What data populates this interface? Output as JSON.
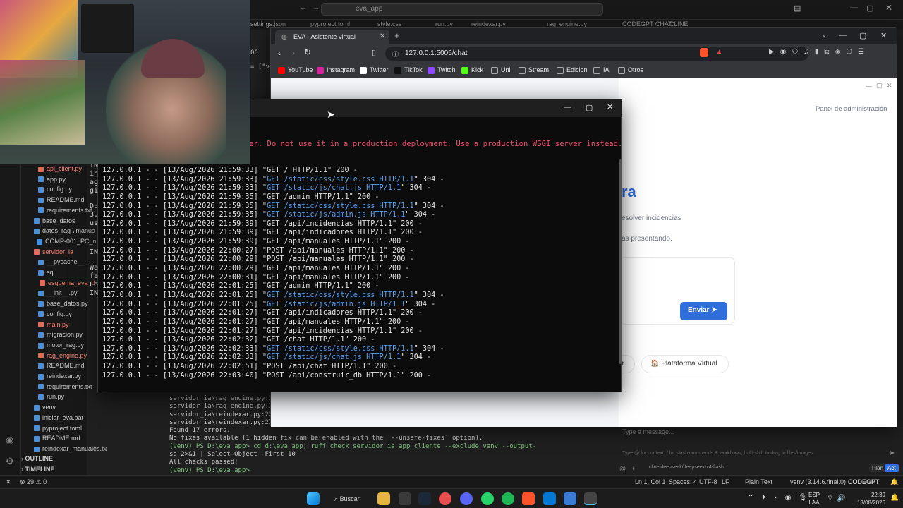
{
  "vscode": {
    "search_text": "eva_app",
    "tabs": [
      "settings.json",
      "pyproject.toml",
      "style.css",
      "run.py",
      "reindexar.py",
      "rag_engine.py",
      "CODEGPT CHAT",
      "CLINE"
    ],
    "tree": [
      {
        "label": "api_client.py",
        "color": "#f48771"
      },
      {
        "label": "app.py",
        "color": "#cccccc"
      },
      {
        "label": "config.py",
        "color": "#cccccc"
      },
      {
        "label": "README.md",
        "color": "#cccccc"
      },
      {
        "label": "requirements.txt",
        "color": "#cccccc"
      },
      {
        "label": "base_datos",
        "color": "#cccccc"
      },
      {
        "label": "datos_rag \\ manua",
        "color": "#cccccc"
      },
      {
        "label": "COMP-001_PC_n",
        "color": "#cccccc"
      },
      {
        "label": "servidor_ia",
        "color": "#f48771"
      },
      {
        "label": "__pycache__",
        "color": "#cccccc"
      },
      {
        "label": "sql",
        "color": "#cccccc"
      },
      {
        "label": "esquema_eva_d",
        "color": "#f48771"
      },
      {
        "label": "__init__.py",
        "color": "#cccccc"
      },
      {
        "label": "base_datos.py",
        "color": "#cccccc"
      },
      {
        "label": "config.py",
        "color": "#cccccc"
      },
      {
        "label": "main.py",
        "color": "#f48771"
      },
      {
        "label": "migracion.py",
        "color": "#cccccc"
      },
      {
        "label": "motor_rag.py",
        "color": "#cccccc"
      },
      {
        "label": "rag_engine.py",
        "color": "#f48771"
      },
      {
        "label": "README.md",
        "color": "#cccccc"
      },
      {
        "label": "reindexar.py",
        "color": "#cccccc"
      },
      {
        "label": "requirements.txt",
        "color": "#cccccc"
      },
      {
        "label": "run.py",
        "color": "#cccccc"
      },
      {
        "label": "venv",
        "color": "#cccccc"
      },
      {
        "label": "iniciar_eva.bat",
        "color": "#cccccc"
      },
      {
        "label": "pyproject.toml",
        "color": "#cccccc"
      },
      {
        "label": "README.md",
        "color": "#cccccc"
      },
      {
        "label": "reindexar_manuales.bat",
        "color": "#cccccc"
      }
    ],
    "outline_label": "OUTLINE",
    "timeline_label": "TIMELINE",
    "terminal_lines": [
      "servidor_ia\\rag_engine.py:159",
      "servidor_ia\\rag_engine.py:173",
      "servidor_ia\\reindexar.py:22:12",
      "servidor_ia\\reindexar.py:27:13",
      "Found 17 errors.",
      "No fixes available (1 hidden fix can be enabled with the `--unsafe-fixes` option).",
      "(venv) PS D:\\eva_app> cd d:\\eva_app; ruff check servidor_ia app_cliente --exclude venv --output-format conci",
      "se 2>&1 | Select-Object -First 10",
      "All checks passed!",
      "(venv) PS D:\\eva_app> "
    ],
    "chat_placeholder": "Type a message...",
    "chat_hint": "Type @ for context, / for slash commands & workflows, hold shift to drag in files/images",
    "chat_model": "cline:deepseek/deepseek-v4-flash",
    "plan_label": "Plan",
    "act_label": "Act",
    "status": {
      "errors": "29",
      "warnings": "0",
      "position": "Ln 1, Col 1",
      "spaces": "Spaces: 4",
      "encoding": "UTF-8",
      "eol": "LF",
      "language": "Plain Text",
      "python": "venv (3.14.6.final.0)",
      "codegpt": "CODEGPT"
    }
  },
  "browser": {
    "tab_title": "EVA - Asistente virtual",
    "url": "127.0.0.1:5005/chat",
    "bookmarks": [
      "YouTube",
      "Instagram",
      "Twitter",
      "TikTok",
      "Twitch",
      "Kick",
      "Uni",
      "Stream",
      "Edicion",
      "IA",
      "Otros"
    ],
    "admin_link": "Panel de administración",
    "heading_fragment": "ra",
    "line1": "esolver incidencias",
    "line2": "ás presentando.",
    "send_button": "Enviar",
    "chip1": "or",
    "chip2": "Plataforma Virtual"
  },
  "console": {
    "warning": "er. Do not use it in a production deployment. Use a production WSGI server instead.",
    "left_fragments": [
      "IN",
      "in",
      "ag",
      "gi",
      "D:",
      "3.",
      "us",
      "IN",
      "Wa",
      "fa",
      "Lo",
      "IN"
    ],
    "log": [
      {
        "pre": "127.0.0.1 - - [13/Aug/2026 21:59:33] \"",
        "req": "GET / HTTP/1.1",
        "post": "\" 200 -",
        "hl": false
      },
      {
        "pre": "127.0.0.1 - - [13/Aug/2026 21:59:33] \"",
        "req": "GET /static/css/style.css HTTP/1.1",
        "post": "\" 304 -",
        "hl": true
      },
      {
        "pre": "127.0.0.1 - - [13/Aug/2026 21:59:33] \"",
        "req": "GET /static/js/chat.js HTTP/1.1",
        "post": "\" 304 -",
        "hl": true
      },
      {
        "pre": "127.0.0.1 - - [13/Aug/2026 21:59:35] \"",
        "req": "GET /admin HTTP/1.1",
        "post": "\" 200 -",
        "hl": false
      },
      {
        "pre": "127.0.0.1 - - [13/Aug/2026 21:59:35] \"",
        "req": "GET /static/css/style.css HTTP/1.1",
        "post": "\" 304 -",
        "hl": true
      },
      {
        "pre": "127.0.0.1 - - [13/Aug/2026 21:59:35] \"",
        "req": "GET /static/js/admin.js HTTP/1.1",
        "post": "\" 304 -",
        "hl": true
      },
      {
        "pre": "127.0.0.1 - - [13/Aug/2026 21:59:39] \"",
        "req": "GET /api/incidencias HTTP/1.1",
        "post": "\" 200 -",
        "hl": false
      },
      {
        "pre": "127.0.0.1 - - [13/Aug/2026 21:59:39] \"",
        "req": "GET /api/indicadores HTTP/1.1",
        "post": "\" 200 -",
        "hl": false
      },
      {
        "pre": "127.0.0.1 - - [13/Aug/2026 21:59:39] \"",
        "req": "GET /api/manuales HTTP/1.1",
        "post": "\" 200 -",
        "hl": false
      },
      {
        "pre": "127.0.0.1 - - [13/Aug/2026 22:00:27] \"",
        "req": "POST /api/manuales HTTP/1.1",
        "post": "\" 200 -",
        "hl": false
      },
      {
        "pre": "127.0.0.1 - - [13/Aug/2026 22:00:29] \"",
        "req": "POST /api/manuales HTTP/1.1",
        "post": "\" 200 -",
        "hl": false
      },
      {
        "pre": "127.0.0.1 - - [13/Aug/2026 22:00:29] \"",
        "req": "GET /api/manuales HTTP/1.1",
        "post": "\" 200 -",
        "hl": false
      },
      {
        "pre": "127.0.0.1 - - [13/Aug/2026 22:00:31] \"",
        "req": "GET /api/manuales HTTP/1.1",
        "post": "\" 200 -",
        "hl": false
      },
      {
        "pre": "127.0.0.1 - - [13/Aug/2026 22:01:25] \"",
        "req": "GET /admin HTTP/1.1",
        "post": "\" 200 -",
        "hl": false
      },
      {
        "pre": "127.0.0.1 - - [13/Aug/2026 22:01:25] \"",
        "req": "GET /static/css/style.css HTTP/1.1",
        "post": "\" 304 -",
        "hl": true
      },
      {
        "pre": "127.0.0.1 - - [13/Aug/2026 22:01:25] \"",
        "req": "GET /static/js/admin.js HTTP/1.1",
        "post": "\" 304 -",
        "hl": true
      },
      {
        "pre": "127.0.0.1 - - [13/Aug/2026 22:01:27] \"",
        "req": "GET /api/indicadores HTTP/1.1",
        "post": "\" 200 -",
        "hl": false
      },
      {
        "pre": "127.0.0.1 - - [13/Aug/2026 22:01:27] \"",
        "req": "GET /api/manuales HTTP/1.1",
        "post": "\" 200 -",
        "hl": false
      },
      {
        "pre": "127.0.0.1 - - [13/Aug/2026 22:01:27] \"",
        "req": "GET /api/incidencias HTTP/1.1",
        "post": "\" 200 -",
        "hl": false
      },
      {
        "pre": "127.0.0.1 - - [13/Aug/2026 22:02:32] \"",
        "req": "GET /chat HTTP/1.1",
        "post": "\" 200 -",
        "hl": false
      },
      {
        "pre": "127.0.0.1 - - [13/Aug/2026 22:02:33] \"",
        "req": "GET /static/css/style.css HTTP/1.1",
        "post": "\" 304 -",
        "hl": true
      },
      {
        "pre": "127.0.0.1 - - [13/Aug/2026 22:02:33] \"",
        "req": "GET /static/js/chat.js HTTP/1.1",
        "post": "\" 304 -",
        "hl": true
      },
      {
        "pre": "127.0.0.1 - - [13/Aug/2026 22:02:51] \"",
        "req": "POST /api/chat HTTP/1.1",
        "post": "\" 200 -",
        "hl": false
      },
      {
        "pre": "127.0.0.1 - - [13/Aug/2026 22:03:40] \"",
        "req": "POST /api/construir_db HTTP/1.1",
        "post": "\" 200 -",
        "hl": false
      }
    ]
  },
  "taskbar": {
    "search_label": "Buscar",
    "lang": "ESP",
    "lang2": "LAA",
    "time": "22:39",
    "date": "13/08/2026"
  },
  "colors": {
    "accent": "#2f6fdb",
    "error_red": "#f0506e",
    "log_blue": "#5aa0f0"
  }
}
